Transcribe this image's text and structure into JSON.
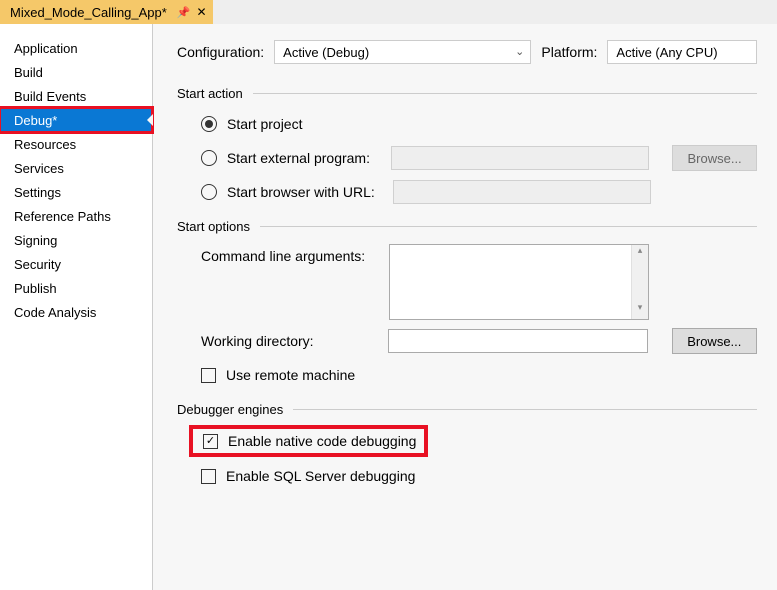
{
  "tab": {
    "title": "Mixed_Mode_Calling_App*"
  },
  "sidebar": {
    "items": [
      {
        "label": "Application"
      },
      {
        "label": "Build"
      },
      {
        "label": "Build Events"
      },
      {
        "label": "Debug*"
      },
      {
        "label": "Resources"
      },
      {
        "label": "Services"
      },
      {
        "label": "Settings"
      },
      {
        "label": "Reference Paths"
      },
      {
        "label": "Signing"
      },
      {
        "label": "Security"
      },
      {
        "label": "Publish"
      },
      {
        "label": "Code Analysis"
      }
    ]
  },
  "config": {
    "configuration_label": "Configuration:",
    "configuration_value": "Active (Debug)",
    "platform_label": "Platform:",
    "platform_value": "Active (Any CPU)"
  },
  "start_action": {
    "title": "Start action",
    "start_project": "Start project",
    "start_external": "Start external program:",
    "start_browser": "Start browser with URL:",
    "browse": "Browse..."
  },
  "start_options": {
    "title": "Start options",
    "cmdline": "Command line arguments:",
    "workdir": "Working directory:",
    "use_remote": "Use remote machine",
    "browse": "Browse..."
  },
  "debugger": {
    "title": "Debugger engines",
    "enable_native": "Enable native code debugging",
    "enable_sql": "Enable SQL Server debugging"
  }
}
